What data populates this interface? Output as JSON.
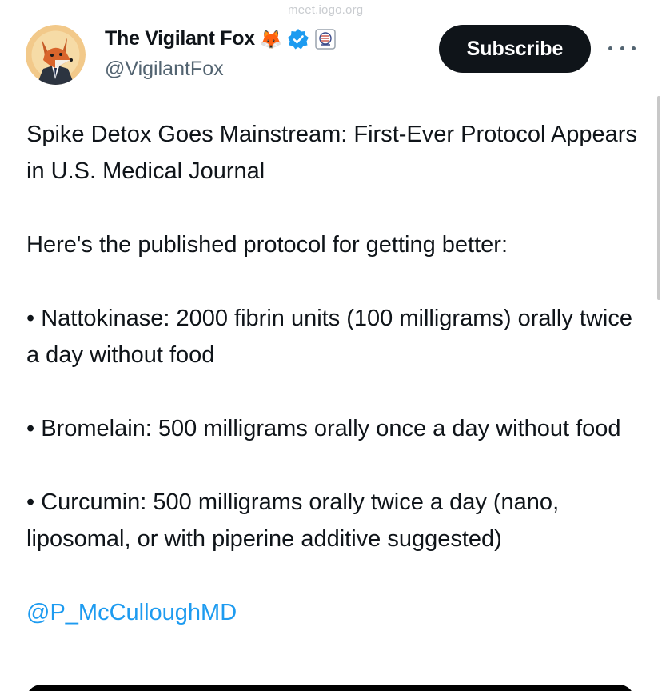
{
  "watermark": "meet.iogo.org",
  "author": {
    "name": "The Vigilant Fox",
    "handle": "@VigilantFox",
    "emoji": "🦊",
    "verified_color": "#1d9bf0"
  },
  "header": {
    "subscribe_label": "Subscribe",
    "more_icon": "more-dots-icon"
  },
  "tweet": {
    "title": "Spike Detox Goes Mainstream: First-Ever Protocol Appears in U.S. Medical Journal",
    "intro": "Here's the published protocol for getting better:",
    "items": [
      "• Nattokinase: 2000 fibrin units (100 milligrams) orally twice a day without food",
      "• Bromelain: 500 milligrams orally once a day without food",
      "• Curcumin: 500 milligrams orally twice a day (nano, liposomal, or with piperine additive suggested)"
    ],
    "mention": "@P_McCulloughMD"
  },
  "colors": {
    "text": "#0f1419",
    "secondary": "#536471",
    "link": "#1d9bf0",
    "button_bg": "#0f1419"
  }
}
